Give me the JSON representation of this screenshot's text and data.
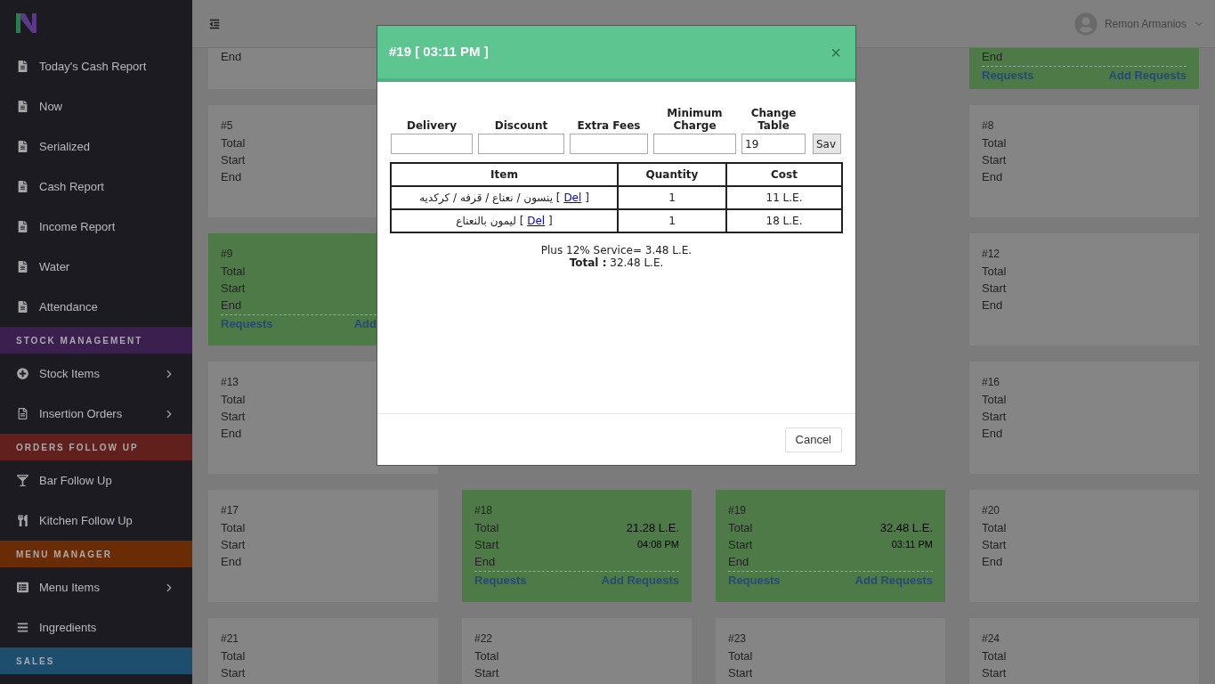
{
  "sidebar": {
    "items": [
      {
        "kind": "link",
        "label": "Today's Cash Report",
        "has_submenu": false
      },
      {
        "kind": "link",
        "label": "Now",
        "has_submenu": false
      },
      {
        "kind": "link",
        "label": "Serialized",
        "has_submenu": false
      },
      {
        "kind": "link",
        "label": "Cash Report",
        "has_submenu": false
      },
      {
        "kind": "link",
        "label": "Income Report",
        "has_submenu": false
      },
      {
        "kind": "link",
        "label": "Water",
        "has_submenu": false
      },
      {
        "kind": "link",
        "label": "Attendance",
        "has_submenu": false
      },
      {
        "kind": "header",
        "label": "STOCK MANAGEMENT",
        "color": "#3b1f4e"
      },
      {
        "kind": "link",
        "label": "Stock Items",
        "has_submenu": true
      },
      {
        "kind": "link",
        "label": "Insertion Orders",
        "has_submenu": true
      },
      {
        "kind": "header",
        "label": "ORDERS FOLLOW UP",
        "color": "#62201c"
      },
      {
        "kind": "link",
        "label": "Bar Follow Up",
        "has_submenu": false
      },
      {
        "kind": "link",
        "label": "Kitchen Follow Up",
        "has_submenu": false
      },
      {
        "kind": "header",
        "label": "MENU MANAGER",
        "color": "#6a2c05"
      },
      {
        "kind": "link",
        "label": "Menu Items",
        "has_submenu": true
      },
      {
        "kind": "link",
        "label": "Ingredients",
        "has_submenu": false
      },
      {
        "kind": "header",
        "label": "SALES",
        "color": "#1d4e6e"
      }
    ]
  },
  "topbar": {
    "user_name": "Remon Armanios"
  },
  "board": {
    "rows": [
      {
        "cards": [
          {
            "active": false,
            "lines": [
              {
                "label": "End"
              }
            ]
          },
          {
            "active": true,
            "lines": [
              {
                "label": "End"
              }
            ],
            "links": [
              "Requests",
              "Add Requests"
            ]
          }
        ]
      },
      {
        "cards": [
          {
            "number": "#5",
            "active": false,
            "lines": [
              {
                "label": "Total"
              },
              {
                "label": "Start"
              },
              {
                "label": "End"
              }
            ]
          },
          {
            "number": "#8",
            "active": false,
            "lines": [
              {
                "label": "Total"
              },
              {
                "label": "Start"
              },
              {
                "label": "End"
              }
            ]
          }
        ]
      },
      {
        "cards": [
          {
            "number": "#9",
            "active": true,
            "lines": [
              {
                "label": "Total"
              },
              {
                "label": "Start"
              },
              {
                "label": "End"
              }
            ],
            "links": [
              "Requests",
              "Add"
            ]
          },
          {
            "number": "#12",
            "active": false,
            "lines": [
              {
                "label": "Total"
              },
              {
                "label": "Start"
              },
              {
                "label": "End"
              }
            ]
          }
        ]
      },
      {
        "cards": [
          {
            "number": "#13",
            "active": false,
            "lines": [
              {
                "label": "Total"
              },
              {
                "label": "Start"
              },
              {
                "label": "End"
              }
            ]
          },
          {
            "number": "#16",
            "active": false,
            "lines": [
              {
                "label": "Total"
              },
              {
                "label": "Start"
              },
              {
                "label": "End"
              }
            ]
          }
        ]
      },
      {
        "cards": [
          {
            "number": "#17",
            "active": false,
            "lines": [
              {
                "label": "Total"
              },
              {
                "label": "Start"
              },
              {
                "label": "End"
              }
            ]
          },
          {
            "number": "#18",
            "active": true,
            "lines": [
              {
                "label": "Total",
                "value": "21.28 L.E."
              },
              {
                "label": "Start",
                "value": "04:08 PM"
              },
              {
                "label": "End"
              }
            ],
            "links": [
              "Requests",
              "Add Requests"
            ]
          },
          {
            "number": "#19",
            "active": true,
            "lines": [
              {
                "label": "Total",
                "value": "32.48 L.E."
              },
              {
                "label": "Start",
                "value": "03:11 PM"
              },
              {
                "label": "End"
              }
            ],
            "links": [
              "Requests",
              "Add Requests"
            ]
          },
          {
            "number": "#20",
            "active": false,
            "lines": [
              {
                "label": "Total"
              },
              {
                "label": "Start"
              },
              {
                "label": "End"
              }
            ]
          }
        ]
      },
      {
        "cards": [
          {
            "number": "#21",
            "active": false,
            "lines": [
              {
                "label": "Total"
              },
              {
                "label": "Start"
              }
            ]
          },
          {
            "number": "#22",
            "active": false,
            "lines": [
              {
                "label": "Total"
              },
              {
                "label": "Start"
              }
            ]
          },
          {
            "number": "#23",
            "active": false,
            "lines": [
              {
                "label": "Total"
              },
              {
                "label": "Start"
              }
            ]
          },
          {
            "number": "#24",
            "active": false,
            "lines": [
              {
                "label": "Total"
              },
              {
                "label": "Start"
              }
            ]
          }
        ]
      }
    ]
  },
  "modal": {
    "title": "#19 [ 03:11 PM ]",
    "close": "×",
    "fields": [
      {
        "label": "Delivery"
      },
      {
        "label": "Discount"
      },
      {
        "label": "Extra Fees"
      },
      {
        "label": "Minimum Charge"
      },
      {
        "label": "Change Table",
        "value": "19"
      }
    ],
    "save_button": "Sav",
    "table": {
      "columns": [
        "Item",
        "Quantity",
        "Cost"
      ],
      "rows": [
        {
          "item": "ينسون / نعناع / قرفه / كركديه",
          "bracket_open": "[",
          "delete_link": "Del",
          "bracket_close": "]",
          "quantity": "1",
          "cost": "11 L.E."
        },
        {
          "item": "ليمون بالنعناع",
          "bracket_open": "[",
          "delete_link": "Del",
          "bracket_close": "]",
          "quantity": "1",
          "cost": "18 L.E."
        }
      ]
    },
    "service_line": "Plus 12% Service= 3.48 L.E.",
    "total_line": "**Total :** 32.48 L.E.",
    "cancel_button": "Cancel"
  }
}
